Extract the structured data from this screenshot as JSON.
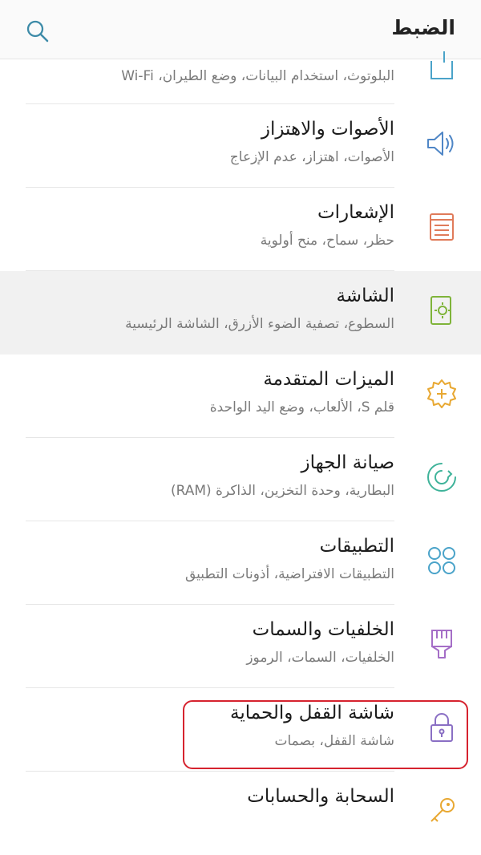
{
  "header": {
    "title": "الضبط",
    "search_icon": "search-icon"
  },
  "items": [
    {
      "title": "",
      "subtitle": "البلوتوث، استخدام البيانات، وضع الطيران، Wi-Fi",
      "icon": "connections-icon",
      "color": "#4aa3c9"
    },
    {
      "title": "الأصوات والاهتزاز",
      "subtitle": "الأصوات، اهتزاز، عدم الإزعاج",
      "icon": "speaker-icon",
      "color": "#4f86c6"
    },
    {
      "title": "الإشعارات",
      "subtitle": "حظر، سماح، منح أولوية",
      "icon": "notifications-icon",
      "color": "#e07b5a"
    },
    {
      "title": "الشاشة",
      "subtitle": "السطوع، تصفية الضوء الأزرق، الشاشة الرئيسية",
      "icon": "display-icon",
      "color": "#7fb43a"
    },
    {
      "title": "الميزات المتقدمة",
      "subtitle": "قلم S، الألعاب، وضع اليد الواحدة",
      "icon": "advanced-features-icon",
      "color": "#e8a832"
    },
    {
      "title": "صيانة الجهاز",
      "subtitle": "البطارية، وحدة التخزين، الذاكرة (RAM)",
      "icon": "device-maintenance-icon",
      "color": "#3fb39a"
    },
    {
      "title": "التطبيقات",
      "subtitle": "التطبيقات الافتراضية، أذونات التطبيق",
      "icon": "apps-icon",
      "color": "#4aa3c9"
    },
    {
      "title": "الخلفيات والسمات",
      "subtitle": "الخلفيات، السمات، الرموز",
      "icon": "themes-icon",
      "color": "#a56ec7"
    },
    {
      "title": "شاشة القفل والحماية",
      "subtitle": "شاشة القفل، بصمات",
      "icon": "lock-icon",
      "color": "#8a6fc4"
    },
    {
      "title": "السحابة والحسابات",
      "subtitle": "",
      "icon": "key-icon",
      "color": "#e8a832"
    }
  ],
  "selected_index": 3,
  "highlight_color": "#d6232f"
}
